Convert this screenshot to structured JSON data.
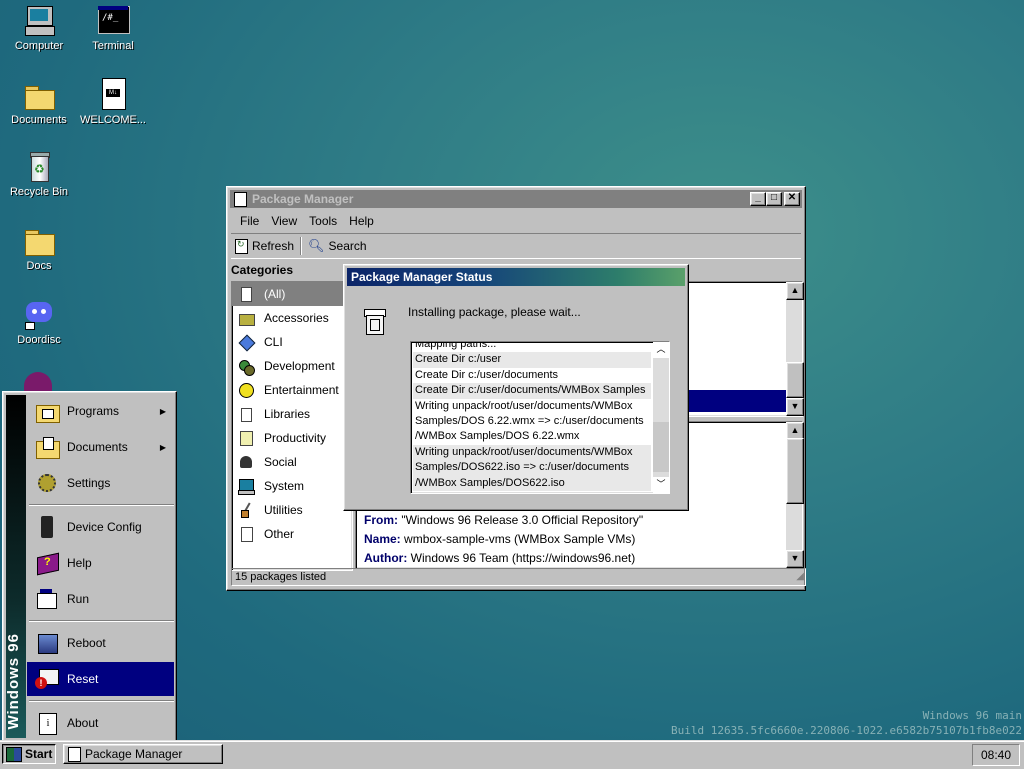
{
  "desktop": {
    "icons": [
      {
        "label": "Computer",
        "icon": "computer-icon"
      },
      {
        "label": "Terminal",
        "icon": "terminal-icon"
      },
      {
        "label": "Documents",
        "icon": "folder-icon"
      },
      {
        "label": "WELCOME...",
        "icon": "markdown-file-icon"
      },
      {
        "label": "Recycle Bin",
        "icon": "recycle-bin-icon"
      },
      {
        "label": "Docs",
        "icon": "folder-icon"
      },
      {
        "label": "Doordisc",
        "icon": "chat-app-icon"
      }
    ],
    "build_line1": "Windows 96 main",
    "build_line2": "Build 12635.5fc6660e.220806-1022.e6582b75107b1fb8e022"
  },
  "package_manager": {
    "title": "Package Manager",
    "menu": [
      "File",
      "View",
      "Tools",
      "Help"
    ],
    "toolbar": {
      "refresh": "Refresh",
      "search": "Search"
    },
    "categories_header": "Categories",
    "categories": [
      "(All)",
      "Accessories",
      "CLI",
      "Development",
      "Entertainment",
      "Libraries",
      "Productivity",
      "Social",
      "System",
      "Utilities",
      "Other"
    ],
    "details": {
      "from_label": "From:",
      "from_value": "\"Windows 96 Release 3.0 Official Repository\"",
      "name_label": "Name:",
      "name_value": "wmbox-sample-vms (WMBox Sample VMs)",
      "author_label": "Author:",
      "author_value": "Windows 96 Team (https://windows96.net)"
    },
    "status": "15 packages listed"
  },
  "status_dialog": {
    "title": "Package Manager Status",
    "message": "Installing package, please wait...",
    "log": [
      "Mapping paths...",
      "Create Dir c:/user",
      "Create Dir c:/user/documents",
      "Create Dir c:/user/documents/WMBox Samples",
      "Writing unpack/root/user/documents/WMBox",
      "Samples/DOS 6.22.wmx => c:/user/documents",
      "/WMBox Samples/DOS 6.22.wmx",
      "Writing unpack/root/user/documents/WMBox",
      "Samples/DOS622.iso => c:/user/documents",
      "/WMBox Samples/DOS622.iso"
    ]
  },
  "start_menu": {
    "brand": "Windows 96",
    "items": [
      "Programs",
      "Documents",
      "Settings",
      "Device Config",
      "Help",
      "Run",
      "Reboot",
      "Reset",
      "About"
    ]
  },
  "taskbar": {
    "start": "Start",
    "task": "Package Manager",
    "clock": "08:40"
  }
}
